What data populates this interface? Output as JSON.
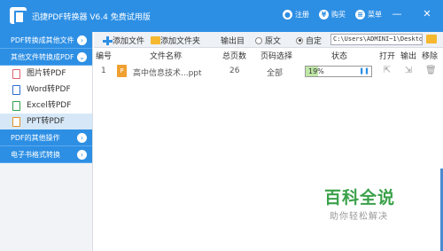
{
  "titlebar": {
    "app_title": "迅捷PDF转换器 V6.4 免费试用版",
    "register": "注册",
    "buy": "购买",
    "menu": "菜单",
    "minimize": "—",
    "close": "✕"
  },
  "sidebar": {
    "categories": [
      {
        "label": "PDF转换成其他文件"
      },
      {
        "label": "其他文件转换成PDF"
      },
      {
        "label": "PDF的其他操作"
      },
      {
        "label": "电子书格式转换"
      }
    ],
    "items": [
      {
        "label": "图片转PDF"
      },
      {
        "label": "Word转PDF"
      },
      {
        "label": "Excel转PDF"
      },
      {
        "label": "PPT转PDF"
      }
    ]
  },
  "toolbar": {
    "add_file": "添加文件",
    "add_folder": "添加文件夹",
    "output_dir": "输出目",
    "original": "原文",
    "custom": "自定",
    "path": "C:\\Users\\ADMINI~1\\Desktop"
  },
  "table": {
    "headers": [
      "编号",
      "文件名称",
      "总页数",
      "页码选择",
      "状态",
      "打开",
      "输出",
      "移除"
    ],
    "rows": [
      {
        "no": "1",
        "name": "高中信息技术...ppt",
        "pages": "26",
        "range": "全部",
        "status": "19%",
        "progress": 0.19
      }
    ]
  },
  "watermark": {
    "title": "百科全说",
    "subtitle": "助你轻松解决"
  },
  "colors": {
    "accent": "#2d8fe4",
    "progress": "#bfe7a6",
    "watermark": "#3aa14a"
  }
}
